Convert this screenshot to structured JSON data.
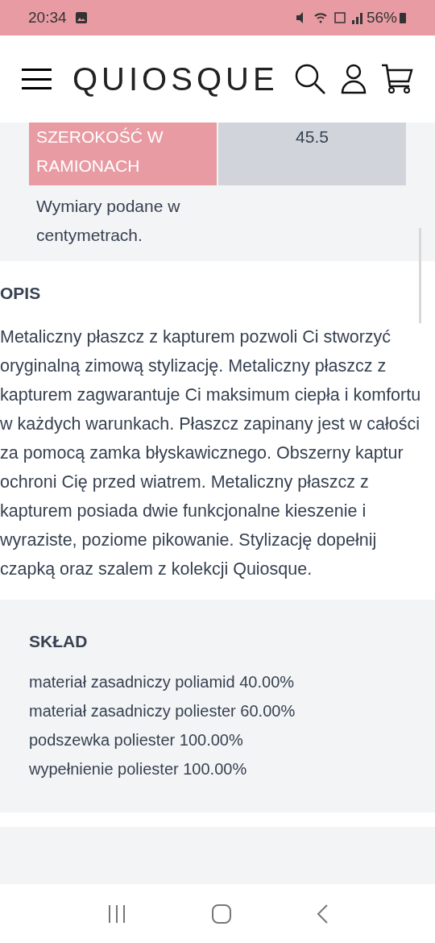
{
  "status_bar": {
    "time": "20:34",
    "battery": "56%"
  },
  "header": {
    "logo": "QUIOSQUE"
  },
  "size_table": {
    "rows": [
      {
        "label": "SZEROKOŚĆ W RAMIONACH",
        "value": "45.5"
      }
    ],
    "note": "Wymiary podane w centymetrach."
  },
  "description": {
    "heading": "OPIS",
    "text": "Metaliczny płaszcz z kapturem pozwoli Ci stworzyć oryginalną zimową stylizację. Metaliczny płaszcz z kapturem zagwarantuje Ci maksimum ciepła i komfortu w każdych warunkach. Płaszcz zapinany jest w całości za pomocą zamka błyskawicznego. Obszerny kaptur ochroni Cię przed wiatrem. Metaliczny płaszcz z kapturem posiada dwie funkcjonalne kieszenie i wyraziste, poziome pikowanie. Stylizację dopełnij czapką oraz szalem z kolekcji Quiosque."
  },
  "composition": {
    "heading": "SKŁAD",
    "items": [
      "materiał zasadniczy poliamid 40.00%",
      "materiał zasadniczy poliester 60.00%",
      "podszewka poliester 100.00%",
      "wypełnienie poliester 100.00%"
    ]
  }
}
